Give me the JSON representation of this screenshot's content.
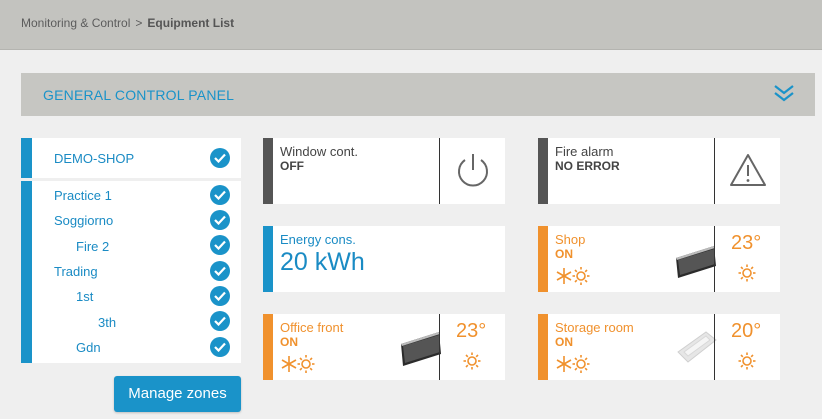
{
  "breadcrumb": {
    "parent": "Monitoring & Control",
    "separator": ">",
    "current": "Equipment List"
  },
  "panel": {
    "title": "GENERAL CONTROL PANEL"
  },
  "zones": {
    "top": "DEMO-SHOP",
    "items": [
      {
        "label": "Practice 1",
        "indent": 0
      },
      {
        "label": "Soggiorno",
        "indent": 0
      },
      {
        "label": "Fire 2",
        "indent": 1
      },
      {
        "label": "Trading",
        "indent": 0
      },
      {
        "label": "1st",
        "indent": 1
      },
      {
        "label": "3th",
        "indent": 2
      },
      {
        "label": "Gdn",
        "indent": 1
      }
    ],
    "manage_label": "Manage zones"
  },
  "tiles": {
    "window": {
      "name": "Window cont.",
      "state": "OFF",
      "icon": "power-icon"
    },
    "fire": {
      "name": "Fire alarm",
      "state": "NO ERROR",
      "icon": "warning-icon"
    },
    "energy": {
      "name": "Energy cons.",
      "value": "20 kWh"
    },
    "shop": {
      "name": "Shop",
      "state": "ON",
      "temp": "23°"
    },
    "office": {
      "name": "Office front",
      "state": "ON",
      "temp": "23°"
    },
    "storage": {
      "name": "Storage room",
      "state": "ON",
      "temp": "20°"
    }
  },
  "colors": {
    "accent": "#1a93c9",
    "orange": "#f0912d",
    "dark": "#555555"
  }
}
